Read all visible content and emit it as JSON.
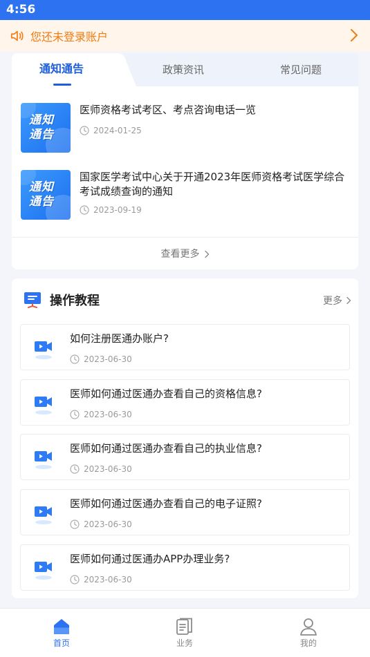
{
  "status_bar": {
    "time": "4:56"
  },
  "login_banner": {
    "text": "您还未登录账户"
  },
  "news": {
    "tabs": [
      "通知通告",
      "政策资讯",
      "常见问题"
    ],
    "thumb_label_line1": "通知",
    "thumb_label_line2": "通告",
    "items": [
      {
        "title": "医师资格考试考区、考点咨询电话一览",
        "date": "2024-01-25"
      },
      {
        "title": "国家医学考试中心关于开通2023年医师资格考试医学综合考试成绩查询的通知",
        "date": "2023-09-19"
      }
    ],
    "see_more": "查看更多"
  },
  "tutorials": {
    "title": "操作教程",
    "more": "更多",
    "items": [
      {
        "title": "如何注册医通办账户?",
        "date": "2023-06-30"
      },
      {
        "title": "医师如何通过医通办查看自己的资格信息?",
        "date": "2023-06-30"
      },
      {
        "title": "医师如何通过医通办查看自己的执业信息?",
        "date": "2023-06-30"
      },
      {
        "title": "医师如何通过医通办查看自己的电子证照?",
        "date": "2023-06-30"
      },
      {
        "title": "医师如何通过医通办APP办理业务?",
        "date": "2023-06-30"
      }
    ]
  },
  "bottom_nav": [
    {
      "label": "首页",
      "icon": "home-icon",
      "active": true
    },
    {
      "label": "业务",
      "icon": "document-icon",
      "active": false
    },
    {
      "label": "我的",
      "icon": "user-icon",
      "active": false
    }
  ],
  "colors": {
    "primary": "#2d72f1",
    "tab_active": "#1d5ed9",
    "warning": "#f07c12",
    "warning_bg": "#fff5ea"
  }
}
